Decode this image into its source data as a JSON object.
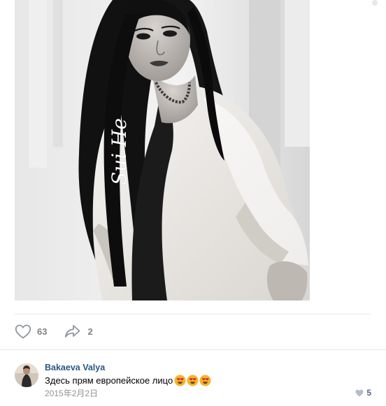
{
  "post": {
    "image_alt": "Black and white portrait photo",
    "signature": "Sui He",
    "actions": {
      "likes": "63",
      "shares": "2"
    }
  },
  "comment": {
    "author": "Bakaeva Valya",
    "text": "Здесь прям европейское лицо",
    "emojis": [
      "heart-eyes",
      "heart-eyes",
      "heart-eyes"
    ],
    "date": "2015年2月2日",
    "likes": "5"
  },
  "colors": {
    "link": "#2a5885",
    "muted": "#828282",
    "divider": "#e7e8ec"
  }
}
